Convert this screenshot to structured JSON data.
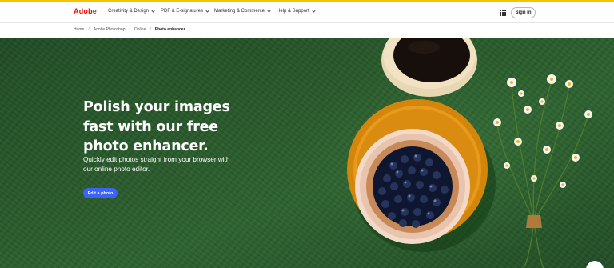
{
  "brand": {
    "logo_text": "Adobe",
    "accent_color": "#eb1000",
    "strip_color": "#f5c400"
  },
  "nav": {
    "items": [
      {
        "label": "Creativity & Design"
      },
      {
        "label": "PDF & E-signatures"
      },
      {
        "label": "Marketing & Commerce"
      },
      {
        "label": "Help & Support"
      }
    ],
    "apps_icon": "app-grid-icon",
    "sign_in_label": "Sign in"
  },
  "breadcrumb": {
    "items": [
      "Home",
      "Adobe Photoshop",
      "Online"
    ],
    "current": "Photo enhancer",
    "separator": "/"
  },
  "hero": {
    "title": "Polish your images fast with our free photo enhancer.",
    "subtitle": "Quickly edit photos straight from your browser with our online photo editor.",
    "cta_label": "Edit a photo",
    "cta_color": "#3b63fb",
    "background_color": "#28592a"
  }
}
